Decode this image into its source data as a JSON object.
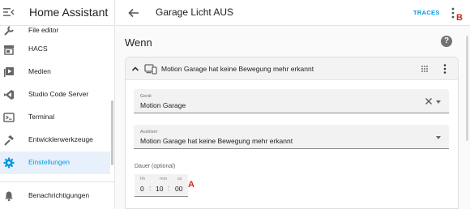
{
  "app": {
    "title": "Home Assistant"
  },
  "sidebar": {
    "items": [
      {
        "label": "File editor",
        "icon": "wrench-icon"
      },
      {
        "label": "HACS",
        "icon": "store-icon"
      },
      {
        "label": "Medien",
        "icon": "media-icon"
      },
      {
        "label": "Studio Code Server",
        "icon": "vscode-icon"
      },
      {
        "label": "Terminal",
        "icon": "terminal-icon"
      },
      {
        "label": "Entwicklerwerkzeuge",
        "icon": "hammer-icon"
      },
      {
        "label": "Einstellungen",
        "icon": "gear-icon",
        "active": true
      },
      {
        "label": "Benachrichtigungen",
        "icon": "bell-icon"
      }
    ]
  },
  "header": {
    "title": "Garage Licht AUS",
    "traces": "TRACES"
  },
  "markers": {
    "a": "A",
    "b": "B"
  },
  "section": {
    "title": "Wenn",
    "help": "?"
  },
  "trigger": {
    "title": "Motion Garage hat keine Bewegung mehr erkannt",
    "device": {
      "label": "Gerät",
      "value": "Motion Garage"
    },
    "trigger_field": {
      "label": "Auslöser",
      "value": "Motion Garage hat keine Bewegung mehr erkannt"
    },
    "duration": {
      "label": "Dauer (optional)",
      "hh_label": "hh",
      "mm_label": "mm",
      "ss_label": "ss",
      "hh": "0",
      "mm": "10",
      "ss": "00",
      "sep": ":"
    }
  },
  "colors": {
    "accent": "#039be5",
    "marker": "#e0201b",
    "active_bg": "#e8f1fb"
  }
}
